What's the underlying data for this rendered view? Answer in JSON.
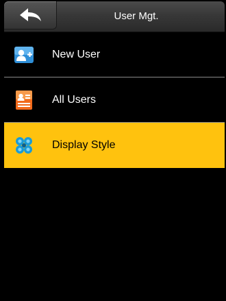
{
  "header": {
    "title": "User Mgt.",
    "back_icon": "back-arrow-icon"
  },
  "menu": {
    "items": [
      {
        "label": "New User",
        "icon": "new-user-icon",
        "icon_color": "#2f8fd8",
        "selected": false
      },
      {
        "label": "All Users",
        "icon": "user-list-icon",
        "icon_color": "#f26a1b",
        "selected": false
      },
      {
        "label": "Display Style",
        "icon": "display-style-icon",
        "icon_color": "#1a9bd7",
        "selected": true
      }
    ]
  },
  "colors": {
    "background": "#000000",
    "selected_row": "#ffc20e",
    "header": "#3a3a3a"
  }
}
